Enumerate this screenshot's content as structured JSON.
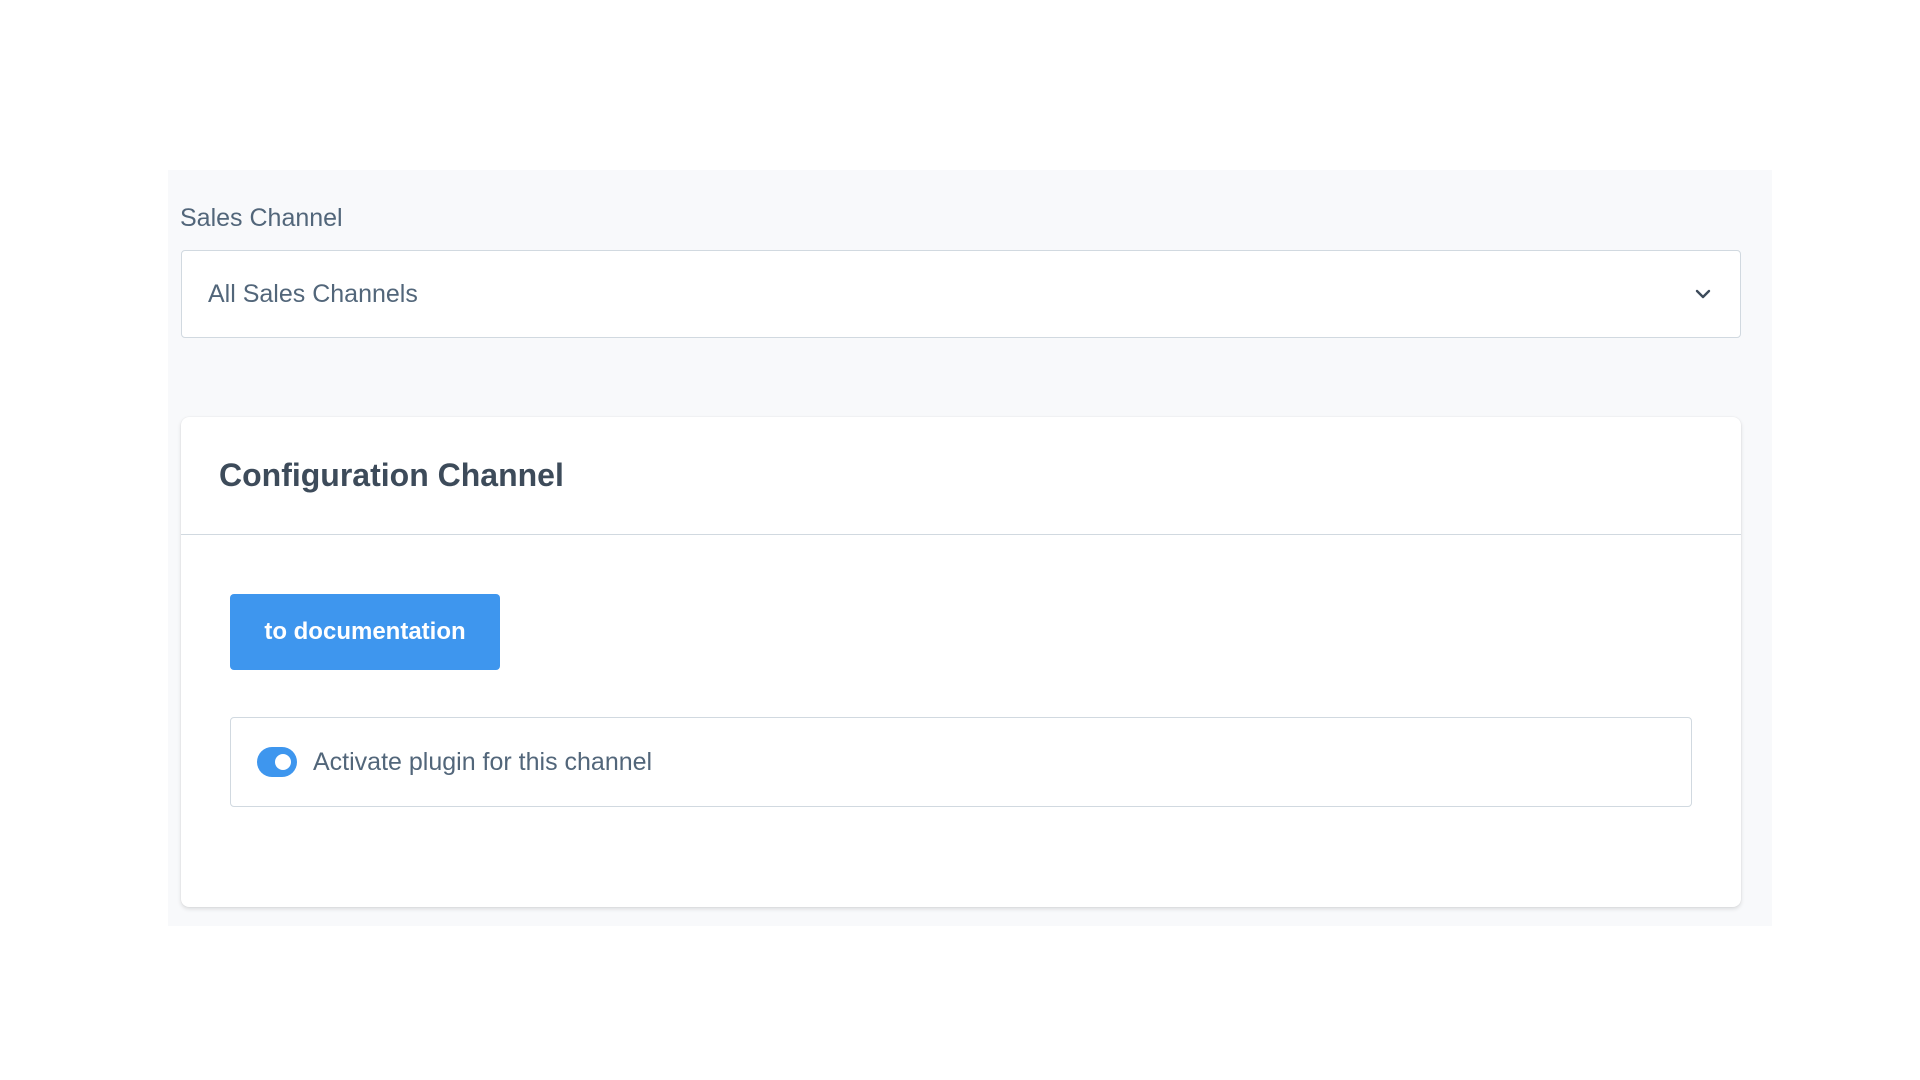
{
  "sales_channel": {
    "label": "Sales Channel",
    "selected_value": "All Sales Channels",
    "dropdown_icon": "chevron-down-icon"
  },
  "card": {
    "title": "Configuration Channel",
    "doc_button_label": "to documentation",
    "toggle": {
      "label": "Activate plugin for this channel",
      "checked": true
    }
  },
  "colors": {
    "accent": "#3e96ee",
    "text": "#52667a",
    "heading": "#3d4b5a",
    "border": "#d1d9e0",
    "panel_background": "#f8f9fb"
  }
}
